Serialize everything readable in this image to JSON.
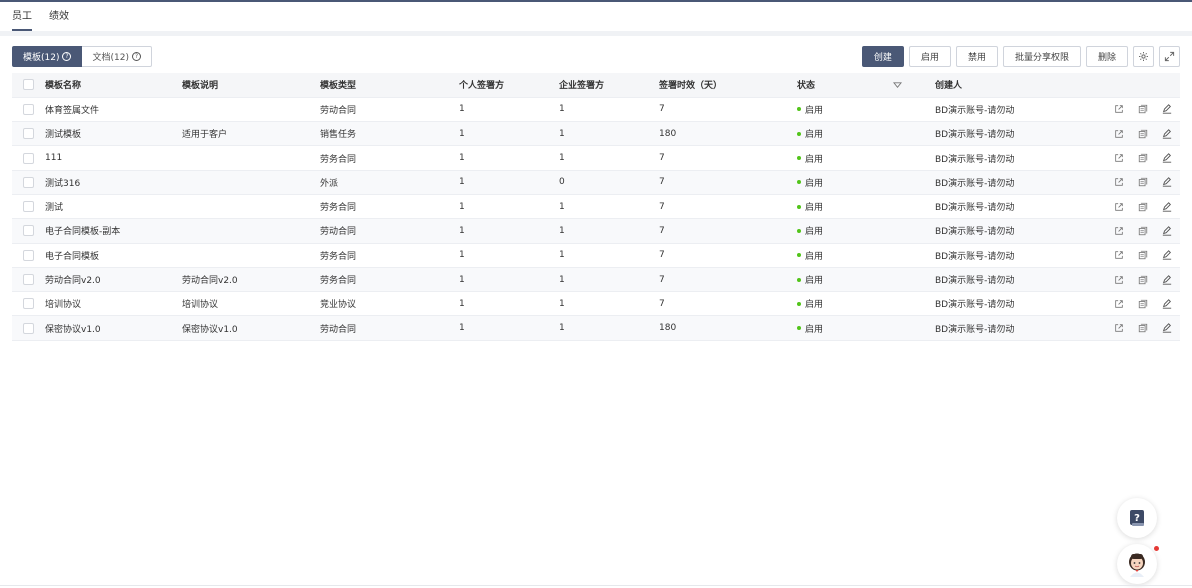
{
  "top_tabs": [
    {
      "label": "员工",
      "active": true
    },
    {
      "label": "绩效",
      "active": false
    }
  ],
  "view_tabs": [
    {
      "label": "模板(12)",
      "active": true
    },
    {
      "label": "文档(12)",
      "active": false
    }
  ],
  "toolbar": {
    "create": "创建",
    "enable": "启用",
    "disable": "禁用",
    "batch_share": "批量分享权限",
    "delete": "删除",
    "settings_icon": "gear-icon",
    "fullscreen_icon": "expand-icon"
  },
  "table": {
    "columns": [
      "模板名称",
      "模板说明",
      "模板类型",
      "个人签署方",
      "企业签署方",
      "签署时效（天）",
      "状态",
      "创建人"
    ],
    "rows": [
      [
        "体育签属文件",
        "",
        "劳动合同",
        "1",
        "1",
        "7",
        "启用",
        "BD演示账号-请勿动"
      ],
      [
        "测试模板",
        "适用于客户",
        "销售任务",
        "1",
        "1",
        "180",
        "启用",
        "BD演示账号-请勿动"
      ],
      [
        "111",
        "",
        "劳务合同",
        "1",
        "1",
        "7",
        "启用",
        "BD演示账号-请勿动"
      ],
      [
        "测试316",
        "",
        "外派",
        "1",
        "0",
        "7",
        "启用",
        "BD演示账号-请勿动"
      ],
      [
        "测试",
        "",
        "劳务合同",
        "1",
        "1",
        "7",
        "启用",
        "BD演示账号-请勿动"
      ],
      [
        "电子合同模板-副本",
        "",
        "劳动合同",
        "1",
        "1",
        "7",
        "启用",
        "BD演示账号-请勿动"
      ],
      [
        "电子合同模板",
        "",
        "劳务合同",
        "1",
        "1",
        "7",
        "启用",
        "BD演示账号-请勿动"
      ],
      [
        "劳动合同v2.0",
        "劳动合同v2.0",
        "劳务合同",
        "1",
        "1",
        "7",
        "启用",
        "BD演示账号-请勿动"
      ],
      [
        "培训协议",
        "培训协议",
        "竞业协议",
        "1",
        "1",
        "7",
        "启用",
        "BD演示账号-请勿动"
      ],
      [
        "保密协议v1.0",
        "保密协议v1.0",
        "劳动合同",
        "1",
        "1",
        "180",
        "启用",
        "BD演示账号-请勿动"
      ]
    ]
  },
  "colors": {
    "accent": "#4a5876",
    "status_enabled": "#52c41a"
  }
}
